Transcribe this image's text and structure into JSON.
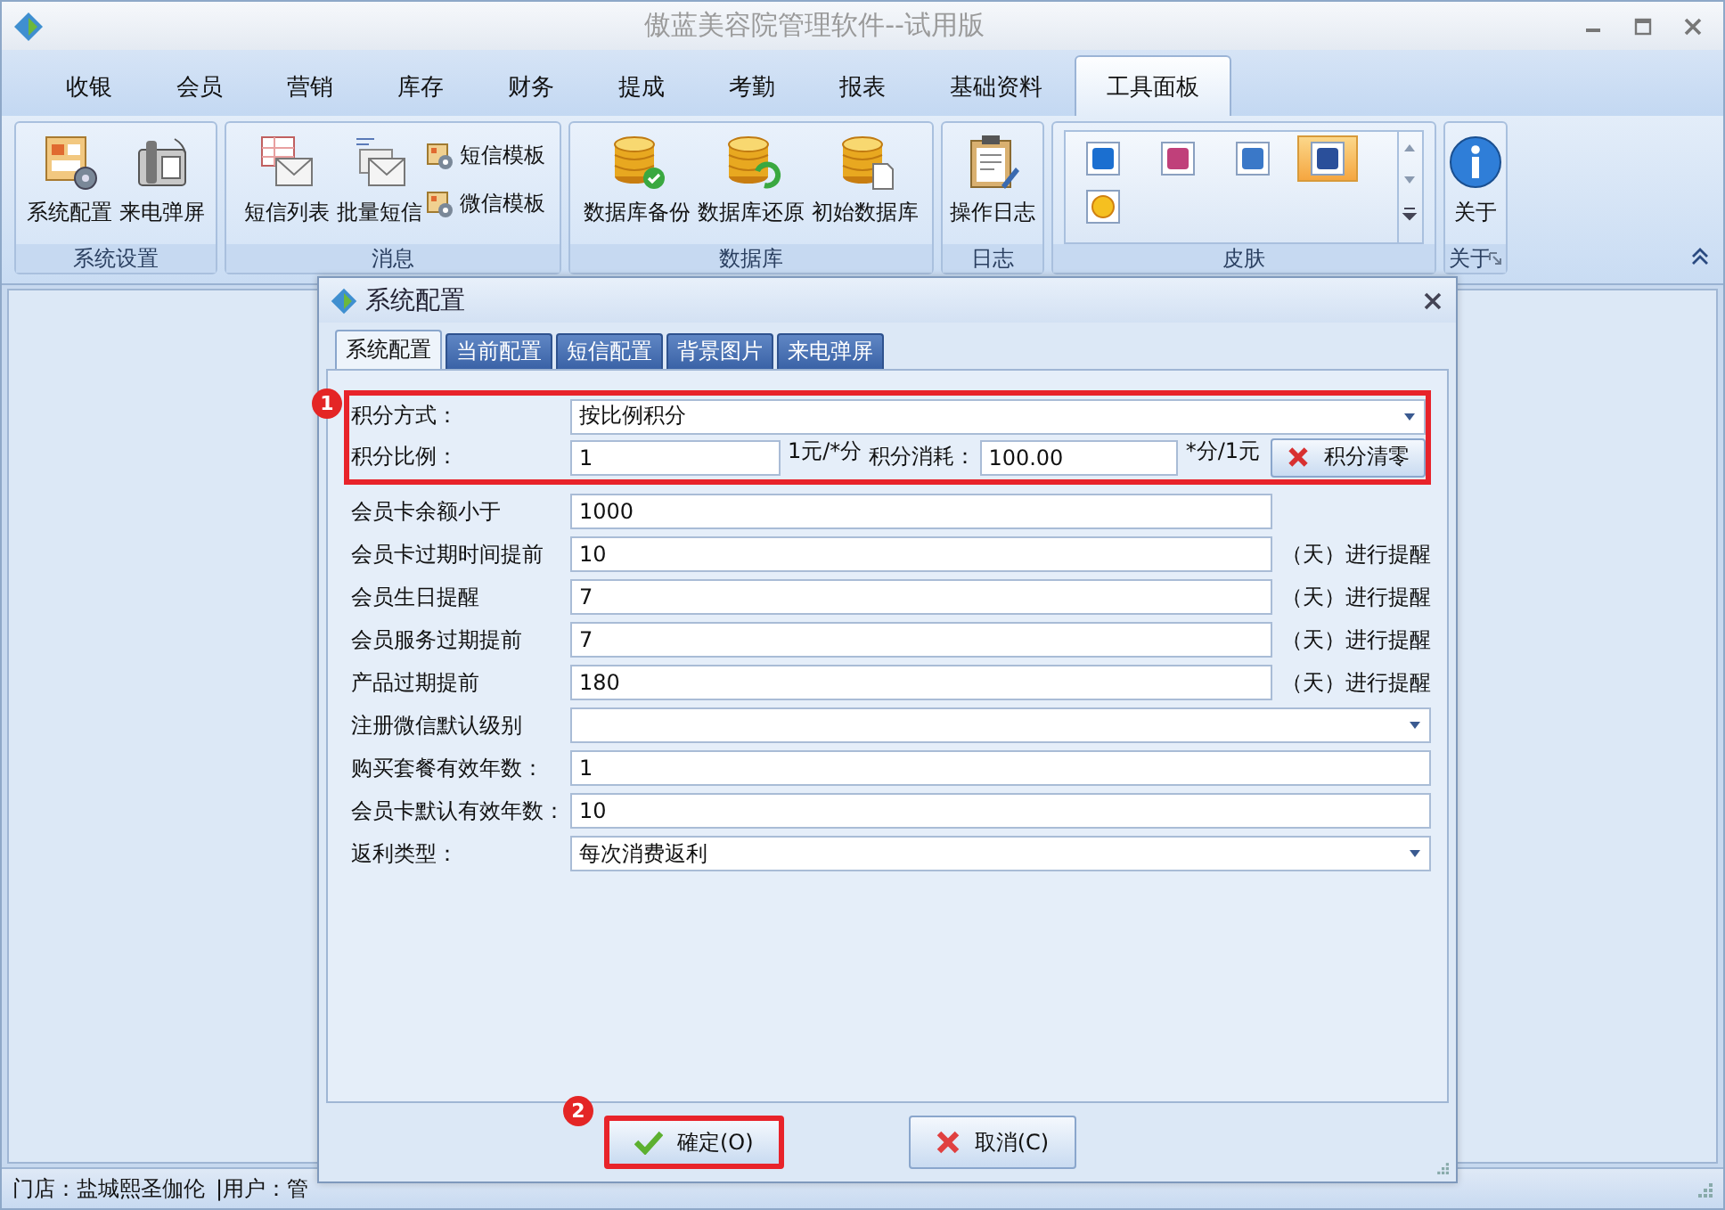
{
  "window": {
    "title": "傲蓝美容院管理软件--试用版"
  },
  "tabs": [
    {
      "label": "收银",
      "selected": false
    },
    {
      "label": "会员",
      "selected": false
    },
    {
      "label": "营销",
      "selected": false
    },
    {
      "label": "库存",
      "selected": false
    },
    {
      "label": "财务",
      "selected": false
    },
    {
      "label": "提成",
      "selected": false
    },
    {
      "label": "考勤",
      "selected": false
    },
    {
      "label": "报表",
      "selected": false
    },
    {
      "label": "基础资料",
      "selected": false
    },
    {
      "label": "工具面板",
      "selected": true
    }
  ],
  "ribbon": {
    "groups": [
      {
        "title": "系统设置",
        "kind": "plain",
        "items": [
          {
            "label": "系统配置",
            "kind": "large"
          },
          {
            "label": "来电弹屏",
            "kind": "large"
          }
        ]
      },
      {
        "title": "消息",
        "kind": "plain",
        "items": [
          {
            "label": "短信列表",
            "kind": "large"
          },
          {
            "label": "批量短信",
            "kind": "large"
          },
          {
            "label": "短信模板",
            "kind": "small"
          },
          {
            "label": "微信模板",
            "kind": "small"
          }
        ]
      },
      {
        "title": "数据库",
        "kind": "plain",
        "items": [
          {
            "label": "数据库备份",
            "kind": "large"
          },
          {
            "label": "数据库还原",
            "kind": "large"
          },
          {
            "label": "初始数据库",
            "kind": "large"
          }
        ]
      },
      {
        "title": "日志",
        "kind": "plain",
        "items": [
          {
            "label": "操作日志",
            "kind": "large"
          }
        ]
      },
      {
        "title": "皮肤",
        "kind": "gallery",
        "skins": [
          {
            "selected": false
          },
          {
            "selected": false
          },
          {
            "selected": false
          },
          {
            "selected": true
          },
          {
            "selected": false
          }
        ]
      },
      {
        "title": "关于",
        "kind": "plain",
        "launcher": true,
        "items": [
          {
            "label": "关于",
            "kind": "large"
          }
        ]
      }
    ]
  },
  "dialog": {
    "title": "系统配置",
    "tabs": [
      {
        "label": "系统配置",
        "selected": true
      },
      {
        "label": "当前配置",
        "selected": false
      },
      {
        "label": "短信配置",
        "selected": false
      },
      {
        "label": "背景图片",
        "selected": false
      },
      {
        "label": "来电弹屏",
        "selected": false
      }
    ],
    "points": {
      "mode": {
        "label": "积分方式：",
        "value": "按比例积分"
      },
      "ratio": {
        "label": "积分比例：",
        "value": "1",
        "unit": "1元/*分"
      },
      "consume": {
        "label": "积分消耗：",
        "value": "100.00",
        "unit": "*分/1元"
      },
      "clear_button": "积分清零"
    },
    "fields": [
      {
        "kind": "short",
        "label": "会员卡余额小于",
        "value": "1000"
      },
      {
        "kind": "short",
        "label": "会员卡过期时间提前",
        "value": "10",
        "suffix": "（天）进行提醒"
      },
      {
        "kind": "short",
        "label": "会员生日提醒",
        "value": "7",
        "suffix": "（天）进行提醒"
      },
      {
        "kind": "short",
        "label": "会员服务过期提前",
        "value": "7",
        "suffix": "（天）进行提醒"
      },
      {
        "kind": "short",
        "label": "产品过期提前",
        "value": "180",
        "suffix": "（天）进行提醒"
      },
      {
        "kind": "combo",
        "label": "注册微信默认级别"
      },
      {
        "kind": "long",
        "label": "购买套餐有效年数：",
        "value": "1"
      },
      {
        "kind": "long",
        "label": "会员卡默认有效年数：",
        "value": "10"
      },
      {
        "kind": "combo",
        "label": "返利类型：",
        "value": "每次消费返利"
      }
    ],
    "buttons": [
      {
        "label": "確定(O)",
        "kind": "ok",
        "highlighted": true
      },
      {
        "label": "取消(C)",
        "kind": "cancel",
        "highlighted": false
      }
    ]
  },
  "annotations": [
    {
      "label": "1"
    },
    {
      "label": "2"
    }
  ],
  "status_bar": {
    "store": "门店：盐城熙圣伽伦",
    "user": "|用户：管"
  }
}
